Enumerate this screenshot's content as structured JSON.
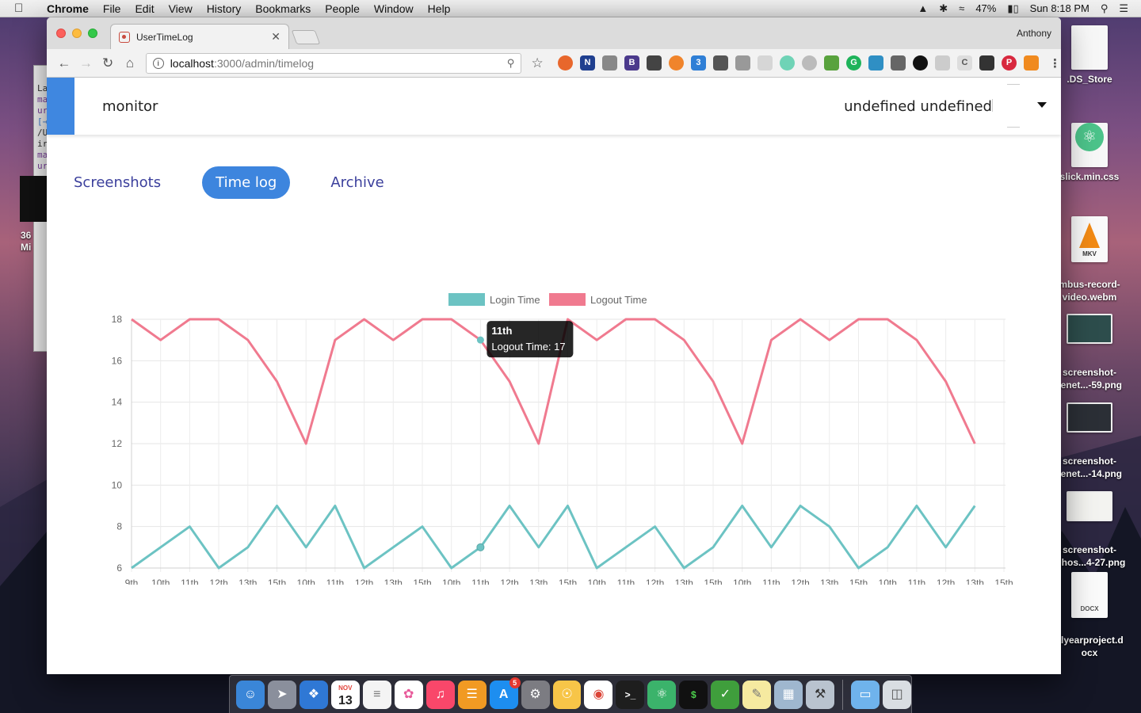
{
  "menubar": {
    "app": "Chrome",
    "items": [
      "File",
      "Edit",
      "View",
      "History",
      "Bookmarks",
      "People",
      "Window",
      "Help"
    ],
    "battery": "47%",
    "clock": "Sun 8:18 PM"
  },
  "desktop": {
    "left_label_line1": "36",
    "left_label_line2": "Mi",
    "terminal_lines": [
      "La",
      "ma",
      "ur",
      "[→",
      "/U",
      "ir",
      "ma",
      "ur",
      "→"
    ],
    "icons": [
      {
        "name": ".DS_Store",
        "type": "file"
      },
      {
        "name": "slick.min.css",
        "type": "atom"
      },
      {
        "name": "mbus-record-\nvideo.webm",
        "type": "vlc",
        "tag": "MKV"
      },
      {
        "name": "screenshot-\nrenet...-59.png",
        "type": "image",
        "tone": "teal"
      },
      {
        "name": "screenshot-\nrenet...-14.png",
        "type": "image",
        "tone": "dark"
      },
      {
        "name": "screenshot-\nalhos...4-27.png",
        "type": "image",
        "tone": "light"
      },
      {
        "name": "alyearproject.d\nocx",
        "type": "doc",
        "tag": "DOCX"
      }
    ]
  },
  "browser": {
    "tab_title": "UserTimeLog",
    "profile": "Anthony",
    "url_host": "localhost",
    "url_path": ":3000/admin/timelog"
  },
  "page": {
    "brand": "monitor",
    "user_name": "undefined undefined",
    "tabs": [
      {
        "label": "Screenshots",
        "active": false
      },
      {
        "label": "Time log",
        "active": true
      },
      {
        "label": "Archive",
        "active": false
      }
    ]
  },
  "chart_data": {
    "type": "line",
    "categories": [
      "9th",
      "10th",
      "11th",
      "12th",
      "13th",
      "15th",
      "10th",
      "11th",
      "12th",
      "13th",
      "15th",
      "10th",
      "11th",
      "12th",
      "13th",
      "15th",
      "10th",
      "11th",
      "12th",
      "13th",
      "15th",
      "10th",
      "11th",
      "12th",
      "13th",
      "15th",
      "10th",
      "11th",
      "12th",
      "13th",
      "15th"
    ],
    "series": [
      {
        "name": "Login Time",
        "color": "#6cc3c3",
        "values": [
          6,
          7,
          8,
          6,
          7,
          9,
          7,
          9,
          6,
          7,
          8,
          6,
          7,
          9,
          7,
          9,
          6,
          7,
          8,
          6,
          7,
          9,
          7,
          9,
          8,
          6,
          7,
          9,
          7,
          9,
          null
        ]
      },
      {
        "name": "Logout Time",
        "color": "#f07a8f",
        "values": [
          18,
          17,
          18,
          18,
          17,
          15,
          12,
          17,
          18,
          17,
          18,
          18,
          17,
          15,
          12,
          18,
          17,
          18,
          18,
          17,
          15,
          12,
          17,
          18,
          17,
          18,
          18,
          17,
          15,
          12,
          null
        ]
      }
    ],
    "ylim": [
      6,
      18
    ],
    "yticks": [
      6,
      8,
      10,
      12,
      14,
      16,
      18
    ],
    "grid": true,
    "legend_position": "top-center",
    "tooltip": {
      "title": "11th",
      "body": "Logout Time: 17",
      "series": "Logout Time",
      "index": 12
    }
  },
  "dock": {
    "calendar_month": "NOV",
    "calendar_day": "13",
    "appstore_badge": "5"
  }
}
